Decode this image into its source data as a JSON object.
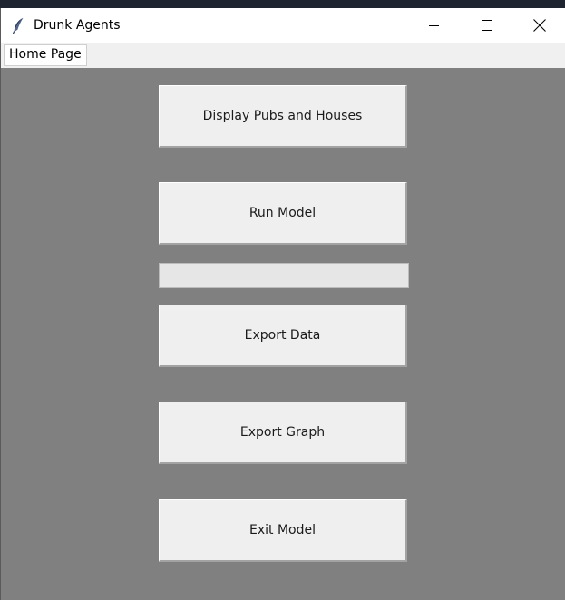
{
  "window": {
    "title": "Drunk Agents",
    "app_icon": "feather-icon",
    "controls": {
      "minimize": "minimize-icon",
      "maximize": "maximize-icon",
      "close": "close-icon"
    }
  },
  "menubar": {
    "items": [
      {
        "label": "Home Page"
      }
    ]
  },
  "main": {
    "buttons": {
      "display": "Display Pubs and Houses",
      "run": "Run Model",
      "export_data": "Export Data",
      "export_graph": "Export Graph",
      "exit": "Exit Model"
    },
    "progress": {
      "value": 0
    }
  },
  "colors": {
    "background": "#808080",
    "button": "#efefef",
    "progress_trough": "#e6e6e6"
  }
}
